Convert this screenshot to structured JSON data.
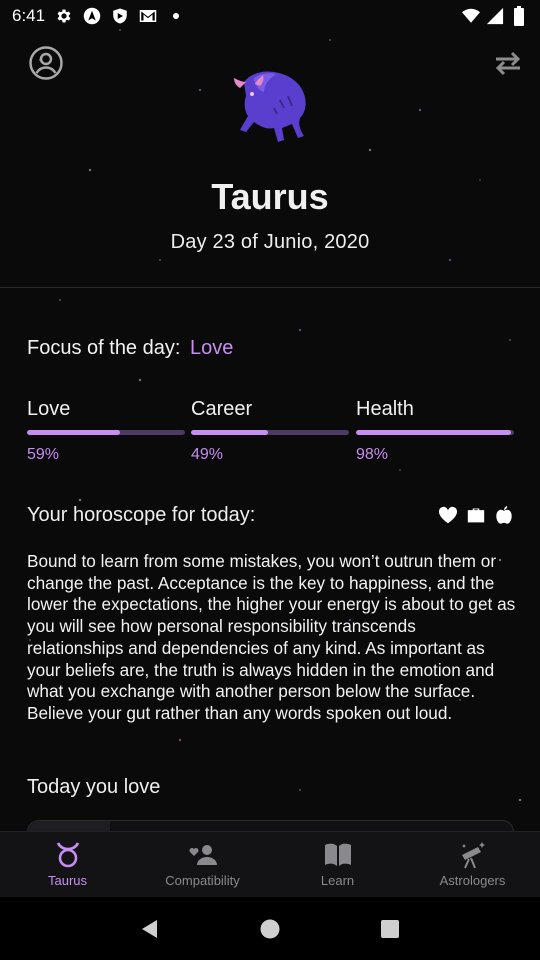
{
  "status_bar": {
    "time": "6:41",
    "icons": [
      "settings-icon",
      "navigation-app-icon",
      "shield-app-icon",
      "gmail-icon",
      "notification-dot-icon"
    ],
    "right_icons": [
      "wifi-icon",
      "signal-icon",
      "battery-icon"
    ]
  },
  "header": {
    "sign_name": "Taurus",
    "date": "Day 23 of Junio, 2020",
    "illustration": "bull-illustration"
  },
  "focus": {
    "label": "Focus of the day:",
    "value": "Love"
  },
  "meters": [
    {
      "label": "Love",
      "percent_text": "59%",
      "value": 0.59
    },
    {
      "label": "Career",
      "percent_text": "49%",
      "value": 0.49
    },
    {
      "label": "Health",
      "percent_text": "98%",
      "value": 0.98
    }
  ],
  "horoscope": {
    "heading": "Your horoscope for today:",
    "icons": [
      "heart-icon",
      "briefcase-icon",
      "apple-icon"
    ],
    "text": "Bound to learn from some mistakes, you won’t outrun them or change the past. Acceptance is the key to happiness, and the lower the expectations, the higher your energy is about to get as you will see how personal responsibility transcends relationships and dependencies of any kind. As important as your beliefs are, the truth is always hidden in the emotion and what you exchange with another person below the surface. Believe your gut rather than any words spoken out loud."
  },
  "today_you_love": {
    "heading": "Today you love"
  },
  "bottom_nav": [
    {
      "label": "Taurus",
      "icon": "taurus-symbol-icon",
      "active": true
    },
    {
      "label": "Compatibility",
      "icon": "people-icon",
      "active": false
    },
    {
      "label": "Learn",
      "icon": "book-icon",
      "active": false
    },
    {
      "label": "Astrologers",
      "icon": "telescope-icon",
      "active": false
    }
  ],
  "colors": {
    "accent": "#c58ef0",
    "background": "#0a0a0b",
    "track": "#4d3a63"
  }
}
